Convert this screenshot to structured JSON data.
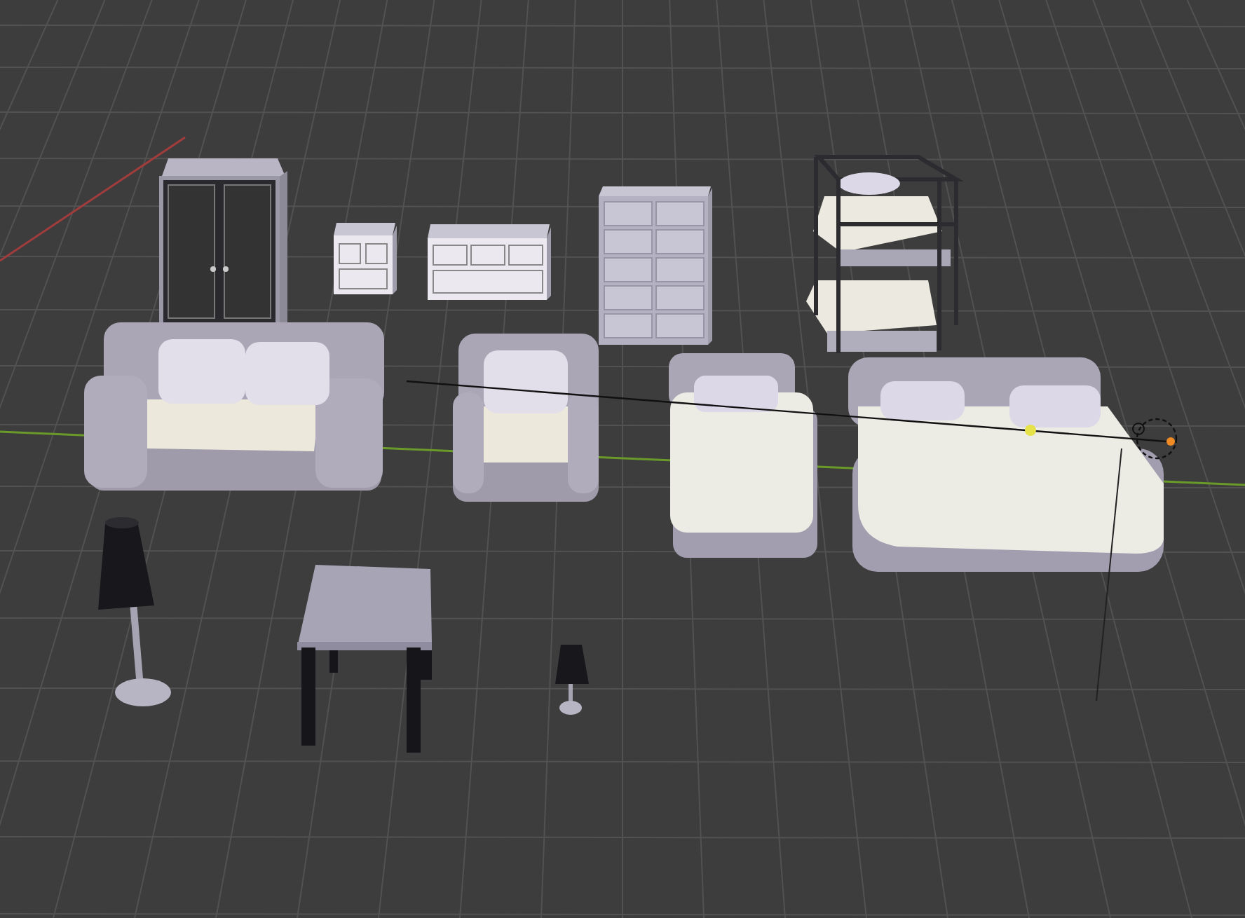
{
  "viewport": {
    "objects": [
      {
        "kind": "wardrobe"
      },
      {
        "kind": "nightstand"
      },
      {
        "kind": "dresser"
      },
      {
        "kind": "chest"
      },
      {
        "kind": "bunk-bed"
      },
      {
        "kind": "sofa"
      },
      {
        "kind": "armchair"
      },
      {
        "kind": "single-bed"
      },
      {
        "kind": "double-bed"
      },
      {
        "kind": "light"
      },
      {
        "kind": "floor-lamp"
      },
      {
        "kind": "side-table"
      },
      {
        "kind": "table-lamp"
      }
    ]
  }
}
